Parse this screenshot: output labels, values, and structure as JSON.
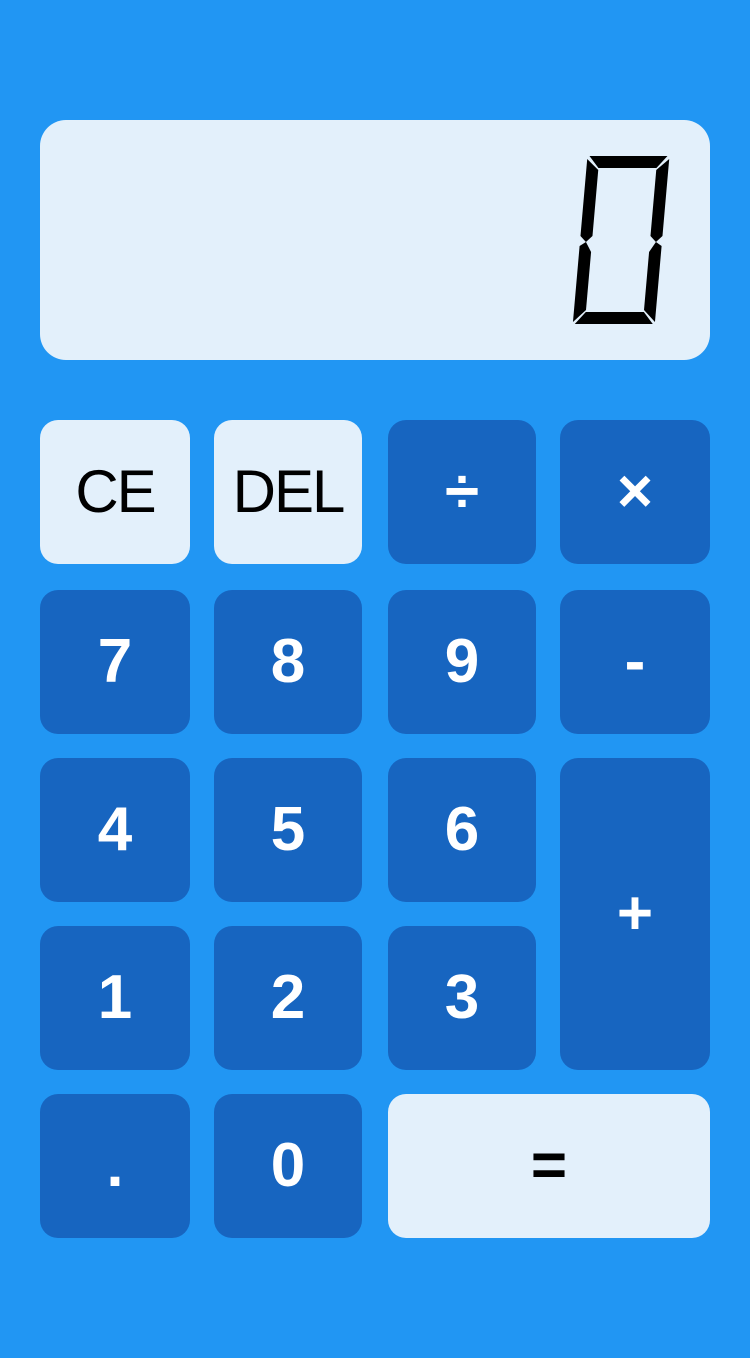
{
  "display": {
    "value": "0"
  },
  "keys": {
    "clear_entry": "CE",
    "delete": "DEL",
    "divide": "÷",
    "multiply": "×",
    "seven": "7",
    "eight": "8",
    "nine": "9",
    "subtract": "-",
    "four": "4",
    "five": "5",
    "six": "6",
    "add": "+",
    "one": "1",
    "two": "2",
    "three": "3",
    "decimal": ".",
    "zero": "0",
    "equals": "="
  },
  "colors": {
    "background": "#2196f3",
    "key_dark": "#1765c0",
    "key_light": "#e3f0fb",
    "display_bg": "#e3f0fb"
  }
}
